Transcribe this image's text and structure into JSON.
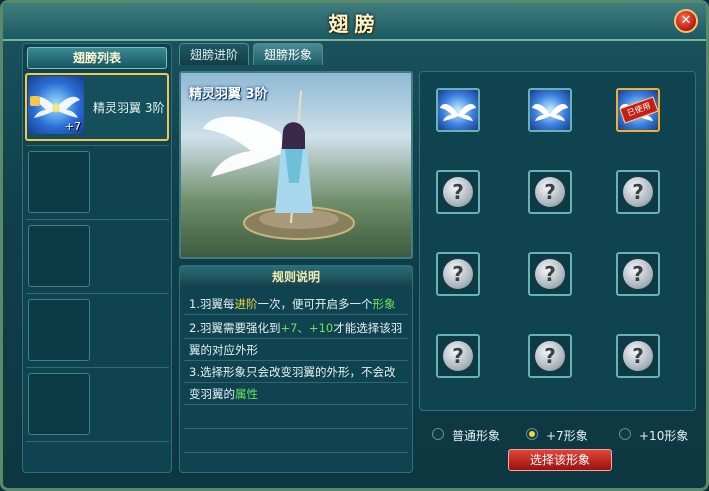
{
  "window": {
    "title": "翅膀",
    "close_icon": "close-icon"
  },
  "list": {
    "header": "翅膀列表",
    "items": [
      {
        "name": "精灵羽翼 3阶",
        "level": "+7",
        "selected": true,
        "icon": "wing-icon"
      }
    ]
  },
  "tabs": [
    {
      "label": "翅膀进阶",
      "active": false
    },
    {
      "label": "翅膀形象",
      "active": true
    }
  ],
  "preview": {
    "name": "精灵羽翼 3阶"
  },
  "rules": {
    "header": "规则说明",
    "lines": [
      [
        "1.羽翼每",
        "进阶",
        "一次，便可开启多一个",
        "形象"
      ],
      [
        "2.羽翼需要强化到",
        "+7、+10",
        "才能选择该羽"
      ],
      [
        "翼的对应外形"
      ],
      [
        "3.选择形象只会改变羽翼的外形，不会改"
      ],
      [
        "变羽翼的",
        "属性"
      ]
    ]
  },
  "appearances": {
    "cells": [
      {
        "state": "unlocked",
        "icon": "wing-icon"
      },
      {
        "state": "unlocked",
        "icon": "wing-icon"
      },
      {
        "state": "selected",
        "icon": "wing-icon",
        "stamp": "已使用"
      },
      {
        "state": "locked",
        "icon": "question-icon"
      },
      {
        "state": "locked",
        "icon": "question-icon"
      },
      {
        "state": "locked",
        "icon": "question-icon"
      },
      {
        "state": "locked",
        "icon": "question-icon"
      },
      {
        "state": "locked",
        "icon": "question-icon"
      },
      {
        "state": "locked",
        "icon": "question-icon"
      },
      {
        "state": "locked",
        "icon": "question-icon"
      },
      {
        "state": "locked",
        "icon": "question-icon"
      },
      {
        "state": "locked",
        "icon": "question-icon"
      }
    ]
  },
  "filters": [
    {
      "label": "普通形象",
      "selected": false
    },
    {
      "label": "+7形象",
      "selected": true
    },
    {
      "label": "+10形象",
      "selected": false
    }
  ],
  "select_button": "选择该形象",
  "colors": {
    "highlight_yellow": "#f0d640",
    "highlight_green": "#6fe05a",
    "select_border": "#f4c64a"
  }
}
